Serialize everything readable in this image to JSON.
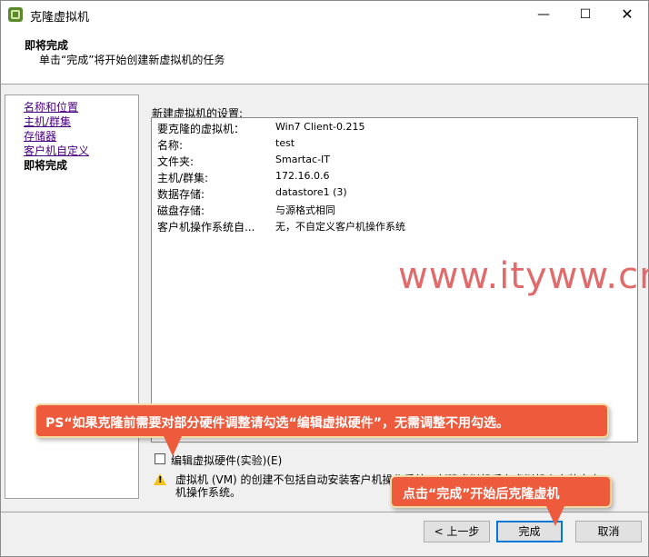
{
  "window": {
    "title": "克隆虚拟机",
    "min_glyph": "—",
    "max_glyph": "☐",
    "close_glyph": "✕"
  },
  "header": {
    "title": "即将完成",
    "subtitle": "单击“完成”将开始创建新虚拟机的任务"
  },
  "nav": {
    "items": [
      {
        "label": "名称和位置"
      },
      {
        "label": "主机/群集"
      },
      {
        "label": "存储器"
      },
      {
        "label": "客户机自定义"
      },
      {
        "label": "即将完成"
      }
    ]
  },
  "settings": {
    "label": "新建虚拟机的设置:",
    "rows": [
      {
        "key": "要克隆的虚拟机：",
        "value": "Win7 Client-0.215"
      },
      {
        "key": "名称:",
        "value": "test"
      },
      {
        "key": "文件夹:",
        "value": "Smartac-IT"
      },
      {
        "key": "主机/群集:",
        "value": "172.16.0.6"
      },
      {
        "key": "数据存储:",
        "value": "datastore1 (3)"
      },
      {
        "key": "磁盘存储:",
        "value": "与源格式相同"
      },
      {
        "key": "客户机操作系统自...",
        "value": "无，不自定义客户机操作系统"
      }
    ]
  },
  "options": {
    "edit_hw_label": "编辑虚拟硬件(实验)(E)",
    "edit_hw_checked": false
  },
  "warning": {
    "line1": "虚拟机 (VM) 的创建不包括自动安装客户机操作系统，创建虚拟机后在虚拟机上安装客户",
    "line2": "机操作系统。"
  },
  "buttons": {
    "back": "< 上一步",
    "finish": "完成",
    "cancel": "取消"
  },
  "watermark": "www.ityww.cn",
  "callouts": {
    "top": "PS“如果克隆前需要对部分硬件调整请勾选“编辑虚拟硬件”，无需调整不用勾选。",
    "bottom": "点击“完成”开始后克隆虚机"
  },
  "colors": {
    "callout": "#ed5a3c",
    "watermark": "#e26a6a",
    "link": "#4b0082",
    "focus": "#0078d7"
  }
}
